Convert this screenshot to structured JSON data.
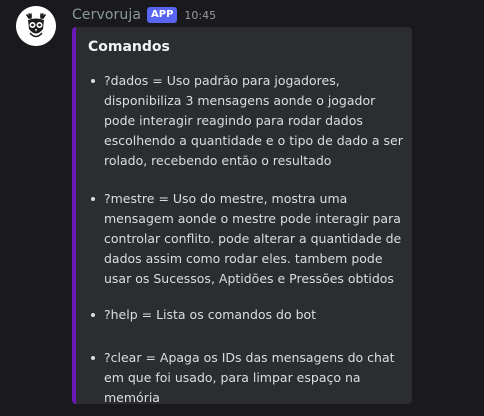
{
  "message": {
    "username": "Cervoruja",
    "badge": "APP",
    "timestamp": "10:45",
    "avatar_icon": "deer-owl-logo"
  },
  "embed": {
    "accent_color": "#6a1ab8",
    "title": "Comandos",
    "commands": [
      {
        "text": "?dados = Uso padrão para jogadores, disponibiliza 3 mensagens aonde o jogador pode interagir reagindo para rodar dados escolhendo a quantidade e o tipo de dado a ser rolado, recebendo então o resultado"
      },
      {
        "text": "?mestre = Uso do mestre, mostra uma mensagem aonde o mestre pode interagir para controlar conflito. pode alterar a quantidade de dados assim como rodar eles. tambem pode usar os Sucessos, Aptidões e Pressões obtidos"
      },
      {
        "text": "?help = Lista os comandos do bot"
      },
      {
        "text": "?clear = Apaga os IDs das mensagens do chat em que foi usado, para limpar espaço na memória"
      }
    ]
  }
}
